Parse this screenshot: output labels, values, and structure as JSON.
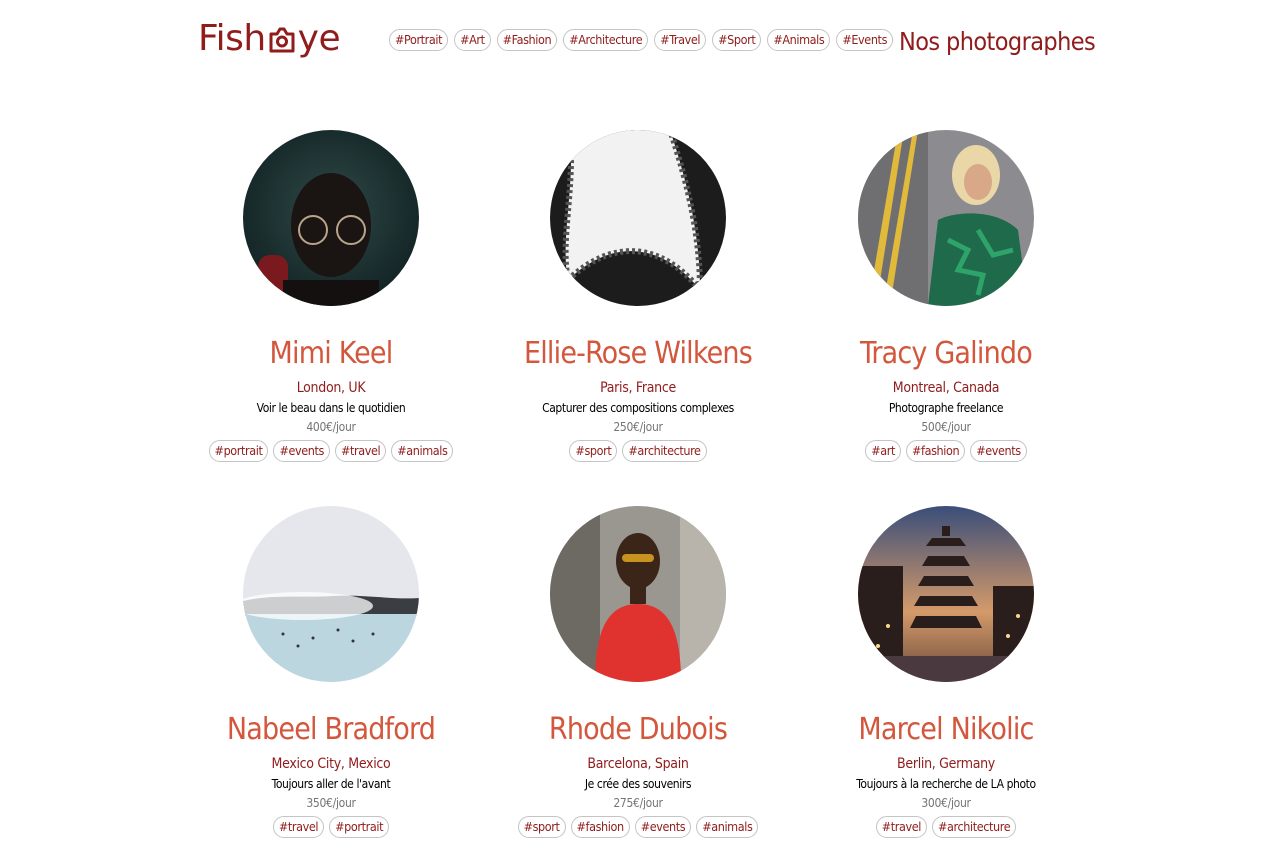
{
  "header": {
    "logo_left": "Fish",
    "logo_right": "ye",
    "title": "Nos photographes",
    "nav_tags": [
      "#Portrait",
      "#Art",
      "#Fashion",
      "#Architecture",
      "#Travel",
      "#Sport",
      "#Animals",
      "#Events"
    ]
  },
  "colors": {
    "brand": "#901C1C",
    "name": "#D3573C",
    "price": "#757575",
    "tag_border": "#C4C4C4"
  },
  "photographers": [
    {
      "name": "Mimi Keel",
      "location": "London, UK",
      "tagline": "Voir le beau dans le quotidien",
      "price": "400€/jour",
      "tags": [
        "#portrait",
        "#events",
        "#travel",
        "#animals"
      ]
    },
    {
      "name": "Ellie-Rose Wilkens",
      "location": "Paris, France",
      "tagline": "Capturer des compositions complexes",
      "price": "250€/jour",
      "tags": [
        "#sport",
        "#architecture"
      ]
    },
    {
      "name": "Tracy Galindo",
      "location": "Montreal, Canada",
      "tagline": "Photographe freelance",
      "price": "500€/jour",
      "tags": [
        "#art",
        "#fashion",
        "#events"
      ]
    },
    {
      "name": "Nabeel Bradford",
      "location": "Mexico City, Mexico",
      "tagline": "Toujours aller de l'avant",
      "price": "350€/jour",
      "tags": [
        "#travel",
        "#portrait"
      ]
    },
    {
      "name": "Rhode Dubois",
      "location": "Barcelona, Spain",
      "tagline": "Je crée des souvenirs",
      "price": "275€/jour",
      "tags": [
        "#sport",
        "#fashion",
        "#events",
        "#animals"
      ]
    },
    {
      "name": "Marcel Nikolic",
      "location": "Berlin, Germany",
      "tagline": "Toujours à la recherche de LA photo",
      "price": "300€/jour",
      "tags": [
        "#travel",
        "#architecture"
      ]
    }
  ]
}
